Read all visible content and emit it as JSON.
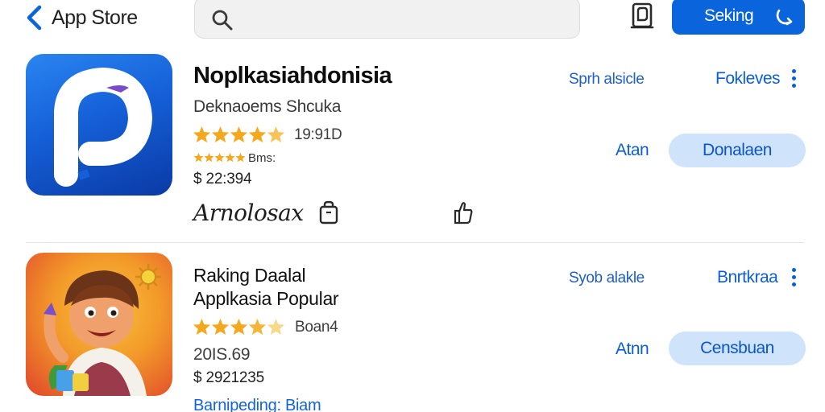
{
  "header": {
    "back_label": "App Store",
    "search_placeholder": "",
    "action_button_label": "Seking"
  },
  "apps": [
    {
      "name": "Noplkasiahdonisia",
      "developer": "Deknaoems Shcuka",
      "rating_count": "19:91D",
      "rating_small": "Bms:",
      "price": "$ 22:394",
      "extra_label": "Arnolosax",
      "right_text": "Sprh alsicle",
      "link_label": "Fokleves",
      "secondary_label": "Atan",
      "button_label": "Donalaen",
      "icon_colors": [
        "#1f78e8",
        "#0b3ea8"
      ],
      "accent": "#7a4cc8"
    },
    {
      "name": "Raking Daalal",
      "subtitle": "Applkasia Popular",
      "rating_count": "Boan4",
      "downloads": "20IS.69",
      "price": "$ 2921235",
      "category": "Barnipeding: Biam",
      "right_text": "Syob alakle",
      "link_label": "Bnrtkraa",
      "secondary_label": "Atnn",
      "button_label": "Censbuan",
      "icon_colors": [
        "#f4b22b",
        "#e0452a"
      ]
    }
  ],
  "colors": {
    "accent": "#0a64dc",
    "pill_bg": "#cfe3fb",
    "star": "#f3a81e"
  }
}
